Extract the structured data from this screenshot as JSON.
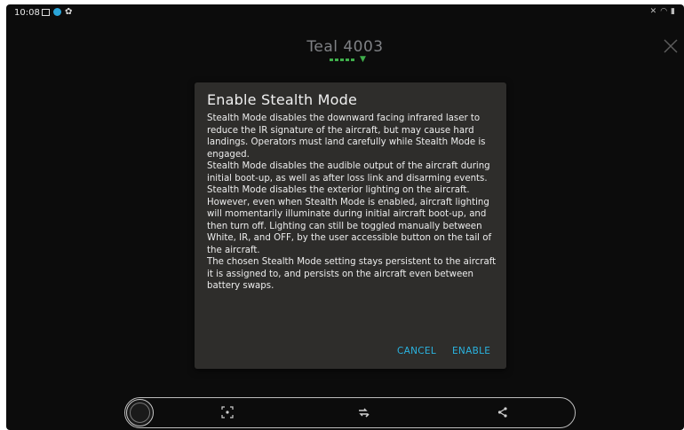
{
  "status_bar": {
    "time": "10:08",
    "left_icons": [
      "image-icon",
      "app-dot-icon",
      "gear-icon"
    ],
    "right_icons": [
      "mute-icon",
      "wifi-icon",
      "battery-icon"
    ]
  },
  "header": {
    "vehicle_name": "Teal 4003"
  },
  "dialog": {
    "title": "Enable Stealth Mode",
    "paragraphs": [
      "Stealth Mode disables the downward facing infrared laser to reduce the IR signature of the aircraft, but may cause hard landings. Operators must land carefully while Stealth Mode is engaged.",
      "Stealth Mode disables the audible output of the aircraft during initial boot-up, as well as after loss link and disarming events.",
      "Stealth Mode disables the exterior lighting on the aircraft. However, even when Stealth Mode is enabled, aircraft lighting will momentarily illuminate during initial aircraft boot-up, and then turn off. Lighting can still be toggled manually between White, IR, and OFF, by the user accessible button on the tail of the aircraft.",
      "The chosen Stealth Mode setting stays persistent to the aircraft it is assigned to, and persists on the aircraft even between battery swaps."
    ],
    "cancel_label": "CANCEL",
    "enable_label": "ENABLE"
  },
  "bottom_bar": {
    "icons": [
      "compass-icon",
      "focus-target-icon",
      "repeat-edit-icon",
      "share-icon"
    ]
  },
  "colors": {
    "background": "#0c0c0c",
    "dialog": "#2e2d2b",
    "accent": "#2ab3e0",
    "signal": "#3fae4b"
  }
}
